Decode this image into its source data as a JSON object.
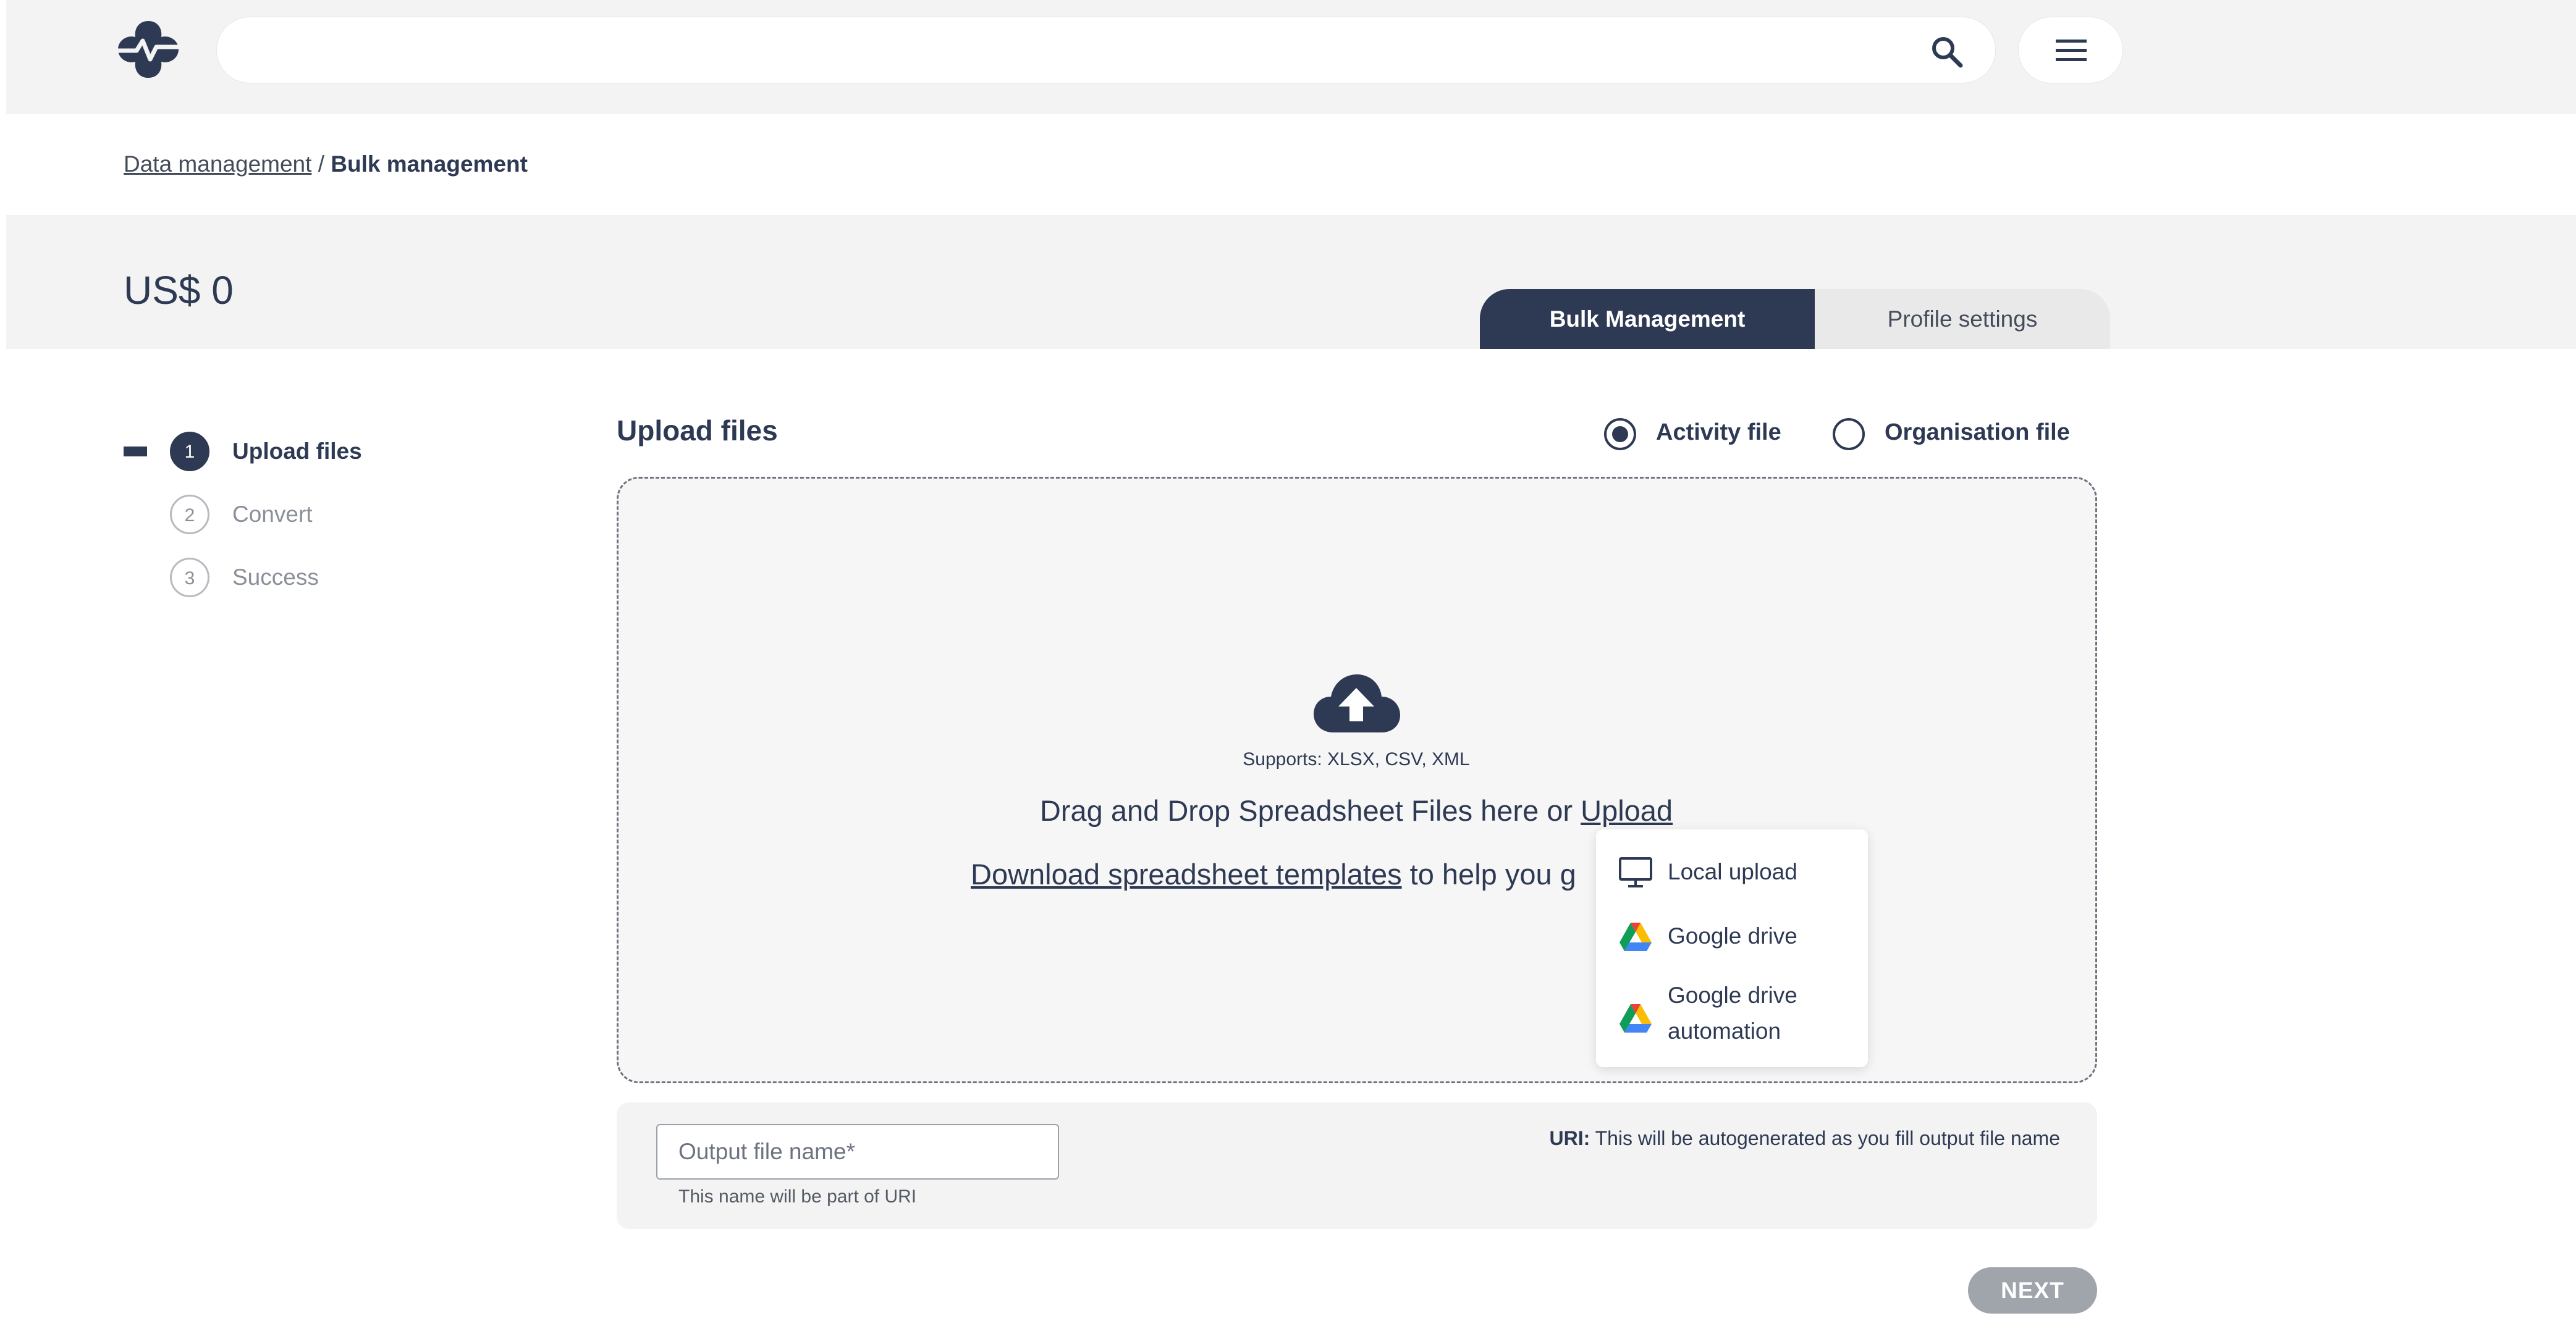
{
  "search": {
    "placeholder": ""
  },
  "breadcrumb": {
    "parent": "Data management",
    "separator": "/",
    "current": "Bulk management"
  },
  "header": {
    "balance": "US$ 0",
    "tabs": [
      {
        "label": "Bulk Management",
        "active": true
      },
      {
        "label": "Profile settings",
        "active": false
      }
    ]
  },
  "stepper": {
    "steps": [
      {
        "number": "1",
        "label": "Upload files",
        "active": true
      },
      {
        "number": "2",
        "label": "Convert",
        "active": false
      },
      {
        "number": "3",
        "label": "Success",
        "active": false
      }
    ]
  },
  "upload": {
    "title": "Upload files",
    "file_types": [
      {
        "label": "Activity file",
        "selected": true
      },
      {
        "label": "Organisation file",
        "selected": false
      }
    ],
    "supports": "Supports: XLSX, CSV, XML",
    "drag_text": "Drag and Drop Spreadsheet Files here or",
    "upload_link": "Upload",
    "template_link": "Download spreadsheet templates",
    "template_suffix": "to help you g",
    "menu": [
      {
        "label": "Local upload",
        "icon": "monitor-icon"
      },
      {
        "label": "Google drive",
        "icon": "google-drive-icon"
      },
      {
        "label": "Google drive automation",
        "icon": "google-drive-icon"
      }
    ]
  },
  "output": {
    "placeholder": "Output file name*",
    "hint": "This name will be part of URI",
    "uri_label": "URI:",
    "uri_text": "This will be autogenerated as you fill output file name"
  },
  "actions": {
    "next": "NEXT"
  },
  "colors": {
    "primary": "#2e3a54",
    "background_gray": "#f3f3f3",
    "disabled_button": "#a0a4ab"
  }
}
